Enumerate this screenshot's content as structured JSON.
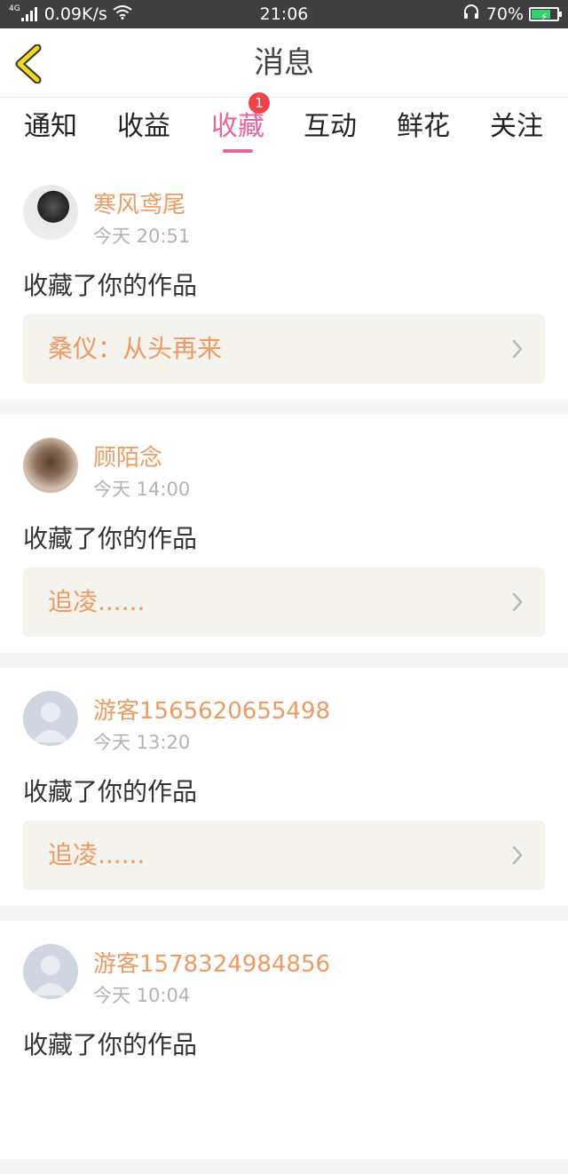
{
  "status_bar": {
    "network_label": "4G",
    "speed": "0.09K/s",
    "time": "21:06",
    "battery": "70%",
    "battery_level": 0.7,
    "icons": [
      "signal-icon",
      "wifi-icon",
      "headset-icon",
      "battery-icon"
    ]
  },
  "header": {
    "title": "消息",
    "back_icon": "chevron-left-icon",
    "accent": "#f2d81e"
  },
  "tabs": [
    {
      "label": "通知",
      "active": false
    },
    {
      "label": "收益",
      "active": false
    },
    {
      "label": "收藏",
      "active": true,
      "badge": "1"
    },
    {
      "label": "互动",
      "active": false
    },
    {
      "label": "鲜花",
      "active": false
    },
    {
      "label": "关注",
      "active": false
    }
  ],
  "colors": {
    "active_tab": "#e865a0",
    "username": "#ee9a62",
    "badge": "#f2424a"
  },
  "messages": [
    {
      "user": "寒风鸢尾",
      "time": "今天 20:51",
      "action": "收藏了你的作品",
      "work": "桑仪：从头再来",
      "avatar": "photo"
    },
    {
      "user": "顾陌念",
      "time": "今天 14:00",
      "action": "收藏了你的作品",
      "work": "追凌......",
      "avatar": "photo"
    },
    {
      "user": "游客1565620655498",
      "time": "今天 13:20",
      "action": "收藏了你的作品",
      "work": "追凌......",
      "avatar": "default"
    },
    {
      "user": "游客1578324984856",
      "time": "今天 10:04",
      "action": "收藏了你的作品",
      "work": "",
      "avatar": "default"
    }
  ]
}
